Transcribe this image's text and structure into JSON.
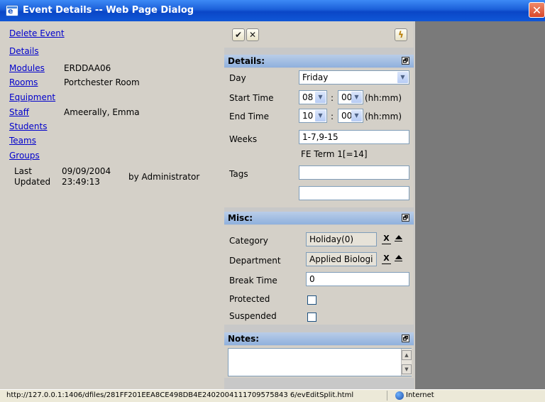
{
  "window": {
    "title": "Event Details -- Web Page Dialog",
    "close_glyph": "✕"
  },
  "left": {
    "delete_event": "Delete Event",
    "details": "Details",
    "modules_label": "Modules",
    "modules_value": "ERDDAA06",
    "rooms_label": "Rooms",
    "rooms_value": "Portchester Room",
    "equipment": "Equipment",
    "staff_label": "Staff",
    "staff_value": "Ameerally, Emma",
    "students": "Students",
    "teams": "Teams",
    "groups": "Groups",
    "last_label_1": "Last",
    "last_label_2": "Updated",
    "last_date": "09/09/2004",
    "last_time": "23:49:13",
    "last_by": "by Administrator"
  },
  "toolbar": {
    "ok_glyph": "✔",
    "cancel_glyph": "✕",
    "lightning_glyph": "ϟ"
  },
  "details": {
    "header": "Details:",
    "toggle_glyph": "🗗",
    "day_label": "Day",
    "day_value": "Friday",
    "start_label": "Start Time",
    "start_hour": "08",
    "start_min": "00",
    "end_label": "End Time",
    "end_hour": "10",
    "end_min": "00",
    "colon": ":",
    "hhmm": "(hh:mm)",
    "weeks_label": "Weeks",
    "weeks_value": "1-7,9-15",
    "term": "FE Term 1[=14]",
    "tags_label": "Tags",
    "tags_value_1": "",
    "tags_value_2": ""
  },
  "misc": {
    "header": "Misc:",
    "category_label": "Category",
    "category_value": "Holiday(0)",
    "department_label": "Department",
    "department_value": "Applied Biologi",
    "break_label": "Break Time",
    "break_value": "0",
    "protected_label": "Protected",
    "suspended_label": "Suspended",
    "clear_glyph": "X"
  },
  "notes": {
    "header": "Notes:",
    "value": ""
  },
  "status": {
    "url": "http://127.0.0.1:1406/dfiles/281FF201EEA8CE498DB4E2402004111709575843 6/evEditSplit.html",
    "zone": "Internet"
  },
  "colors": {
    "title_bar": "#1b5fd9",
    "section_header": "#8fb0dd",
    "link": "#0000cc",
    "right_area": "#7a7a7a"
  }
}
